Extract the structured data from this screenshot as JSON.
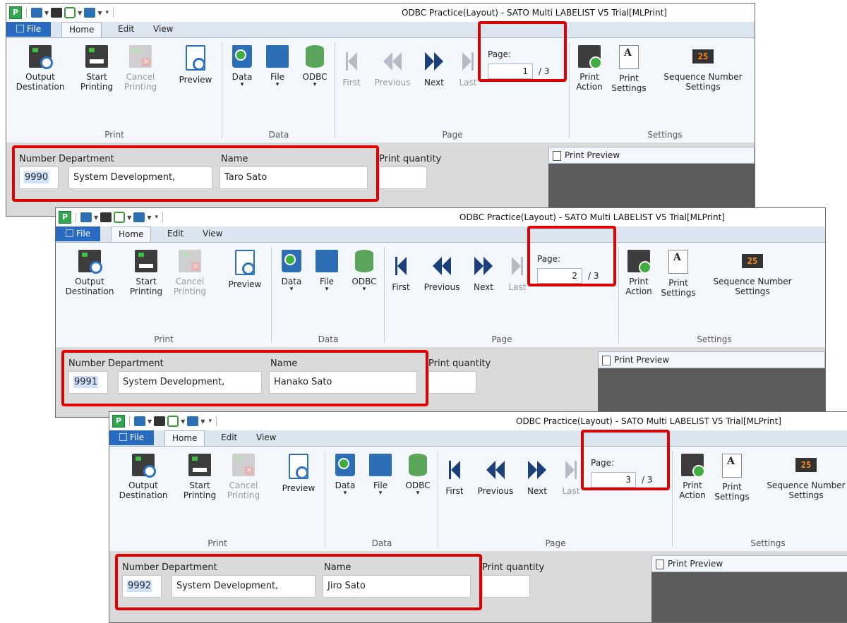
{
  "app_title": "ODBC Practice(Layout) - SATO Multi LABELIST V5 Trial[MLPrint]",
  "app_logo": "P",
  "tabs": [
    "File",
    "Home",
    "Edit",
    "View"
  ],
  "ribbon": {
    "output_destination": [
      "Output",
      "Destination"
    ],
    "start_printing": [
      "Start",
      "Printing"
    ],
    "cancel_printing": [
      "Cancel",
      "Printing"
    ],
    "preview": "Preview",
    "data": "Data",
    "file": "File",
    "odbc": "ODBC",
    "first": "First",
    "previous": "Previous",
    "next": "Next",
    "last": "Last",
    "page_label": "Page:",
    "print_action": [
      "Print",
      "Action"
    ],
    "print_settings": [
      "Print",
      "Settings"
    ],
    "sequence_number": [
      "Sequence Number",
      "Settings"
    ],
    "seq_icon_text": "25",
    "group_print": "Print",
    "group_data": "Data",
    "group_page": "Page",
    "group_settings": "Settings"
  },
  "fields": {
    "number_label": "Number",
    "department_label": "Department",
    "name_label": "Name",
    "print_quantity_label": "Print quantity",
    "print_preview_label": "Print Preview"
  },
  "windows": [
    {
      "page_current": "1",
      "page_total": "/ 3",
      "number": "9990",
      "department": "System Development,",
      "name": "Taro Sato",
      "first_enabled": false,
      "previous_enabled": false
    },
    {
      "page_current": "2",
      "page_total": "/ 3",
      "number": "9991",
      "department": "System Development,",
      "name": "Hanako Sato",
      "first_enabled": true,
      "previous_enabled": true
    },
    {
      "page_current": "3",
      "page_total": "/ 3",
      "number": "9992",
      "department": "System Development,",
      "name": "Jiro Sato",
      "first_enabled": true,
      "previous_enabled": true
    }
  ],
  "colors": {
    "highlight": "#e00000",
    "file_tab": "#2a6bc2",
    "ribbon": "#f4f7fb"
  }
}
